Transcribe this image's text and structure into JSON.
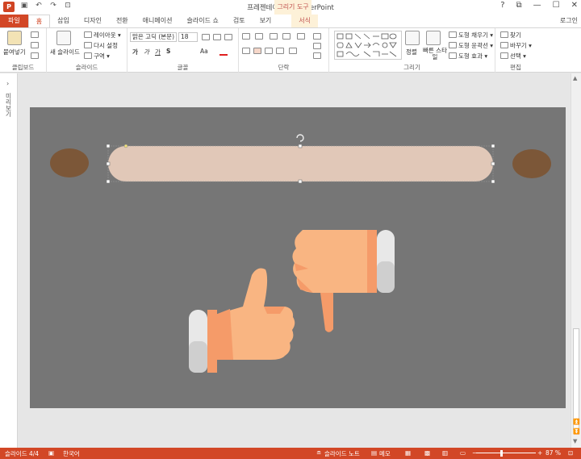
{
  "window": {
    "title": "프레젠테이션1 - PowerPoint",
    "context_tool": "그리기 도구",
    "app_icon": "P",
    "controls": [
      "?",
      "⧉",
      "—",
      "☐",
      "✕"
    ]
  },
  "qat": {
    "icons": [
      "save-icon",
      "undo-icon",
      "redo-icon",
      "present-icon"
    ],
    "glyphs": [
      "▣",
      "↶",
      "↷",
      "⊡"
    ]
  },
  "tabs": [
    {
      "label": "파일",
      "kind": "file"
    },
    {
      "label": "홈",
      "kind": "active"
    },
    {
      "label": "삽입",
      "kind": ""
    },
    {
      "label": "디자인",
      "kind": ""
    },
    {
      "label": "전환",
      "kind": ""
    },
    {
      "label": "애니메이션",
      "kind": ""
    },
    {
      "label": "슬라이드 쇼",
      "kind": ""
    },
    {
      "label": "검토",
      "kind": ""
    },
    {
      "label": "보기",
      "kind": ""
    },
    {
      "label": "서식",
      "kind": "ctx"
    }
  ],
  "login": "로그인",
  "ribbon": {
    "clipboard": {
      "label": "클립보드",
      "paste": "붙여넣기"
    },
    "slides": {
      "label": "슬라이드",
      "new_slide": "새 슬라이드",
      "layout": "레이아웃 ▾",
      "reset": "다시 설정",
      "section": "구역 ▾"
    },
    "font": {
      "label": "글꼴",
      "font_name": "맑은 고딕 (본문)",
      "font_size": "18",
      "bold": "가",
      "italic": "가",
      "underline": "가",
      "strike": "S",
      "font_color": "Aa"
    },
    "paragraph": {
      "label": "단락"
    },
    "drawing": {
      "label": "그리기",
      "arrange": "정렬",
      "quick_styles": "빠른 스타일",
      "fill": "도형 채우기 ▾",
      "outline": "도형 윤곽선 ▾",
      "effects": "도형 효과 ▾"
    },
    "editing": {
      "label": "편집",
      "find": "찾기",
      "replace": "바꾸기 ▾",
      "select": "선택 ▾"
    }
  },
  "left_pane": {
    "label": "미리보기"
  },
  "colors": {
    "accent": "#d24726",
    "slide_bg": "#767676",
    "bar_fill": "#e1c8b8",
    "oval_fill": "#7c5738",
    "skin": "#f9b582",
    "skin_shade": "#f59b69",
    "cuff": "#e8e8e8",
    "cuff_shade": "#cfcfcf"
  },
  "status": {
    "slide_info": "슬라이드 4/4",
    "language": "한국어",
    "notes": "슬라이드 노트",
    "comments": "메모",
    "zoom": "87 %",
    "zoom_minus": "−",
    "zoom_plus": "+"
  }
}
